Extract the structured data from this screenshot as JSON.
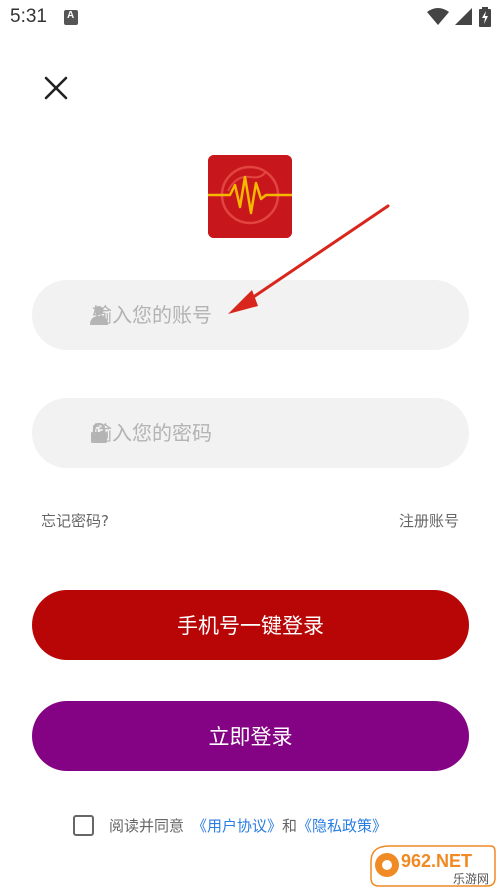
{
  "status_bar": {
    "time": "5:31",
    "icons": [
      "a-notification-icon",
      "wifi-icon",
      "signal-icon",
      "battery-charging-icon"
    ]
  },
  "header": {
    "close_icon": "close-icon"
  },
  "logo": {
    "icon": "heartbeat-logo-icon",
    "colors": {
      "background": "#c8161d",
      "line": "#f5b800"
    }
  },
  "form": {
    "account": {
      "placeholder": "输入您的账号",
      "value": "",
      "icon": "user-icon"
    },
    "password": {
      "placeholder": "输入您的密码",
      "value": "",
      "icon": "lock-icon"
    },
    "forgot_label": "忘记密码?",
    "register_label": "注册账号"
  },
  "buttons": {
    "phone_login_label": "手机号一键登录",
    "login_label": "立即登录"
  },
  "agreement": {
    "prefix": "阅读并同意",
    "user_agreement": "《用户协议》",
    "conjunction": "和",
    "privacy_policy": "《隐私政策》",
    "checked": false
  },
  "watermark": {
    "main": "962.NET",
    "sub": "乐游网"
  },
  "colors": {
    "phone_button": "#b80505",
    "login_button": "#830384",
    "link": "#2a7de1",
    "arrow": "#d9261c"
  }
}
